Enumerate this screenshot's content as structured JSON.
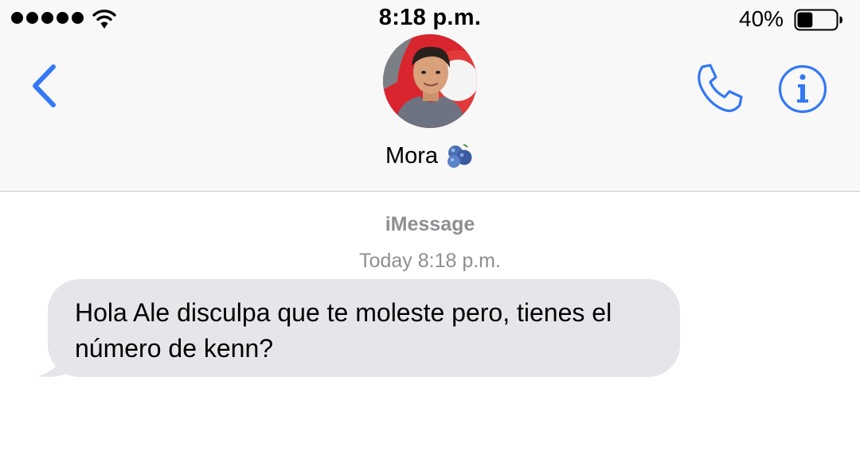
{
  "status_bar": {
    "time": "8:18 p.m.",
    "battery_percent": "40%",
    "battery_level": 0.4,
    "signal_bars": 5,
    "icons": [
      "signal-dots",
      "wifi-icon",
      "battery-icon"
    ]
  },
  "nav": {
    "back_icon": "chevron-left-icon",
    "call_icon": "phone-icon",
    "info_icon": "info-icon",
    "contact_name": "Mora",
    "contact_emoji": "blueberries-emoji",
    "accent_color": "#3478f6"
  },
  "conversation": {
    "service": "iMessage",
    "timestamp_day": "Today",
    "timestamp_time": "8:18 p.m.",
    "messages": [
      {
        "direction": "incoming",
        "text": "Hola Ale disculpa que te moleste pero, tienes el número de kenn?",
        "bubble_color": "#e5e5ea"
      }
    ]
  }
}
